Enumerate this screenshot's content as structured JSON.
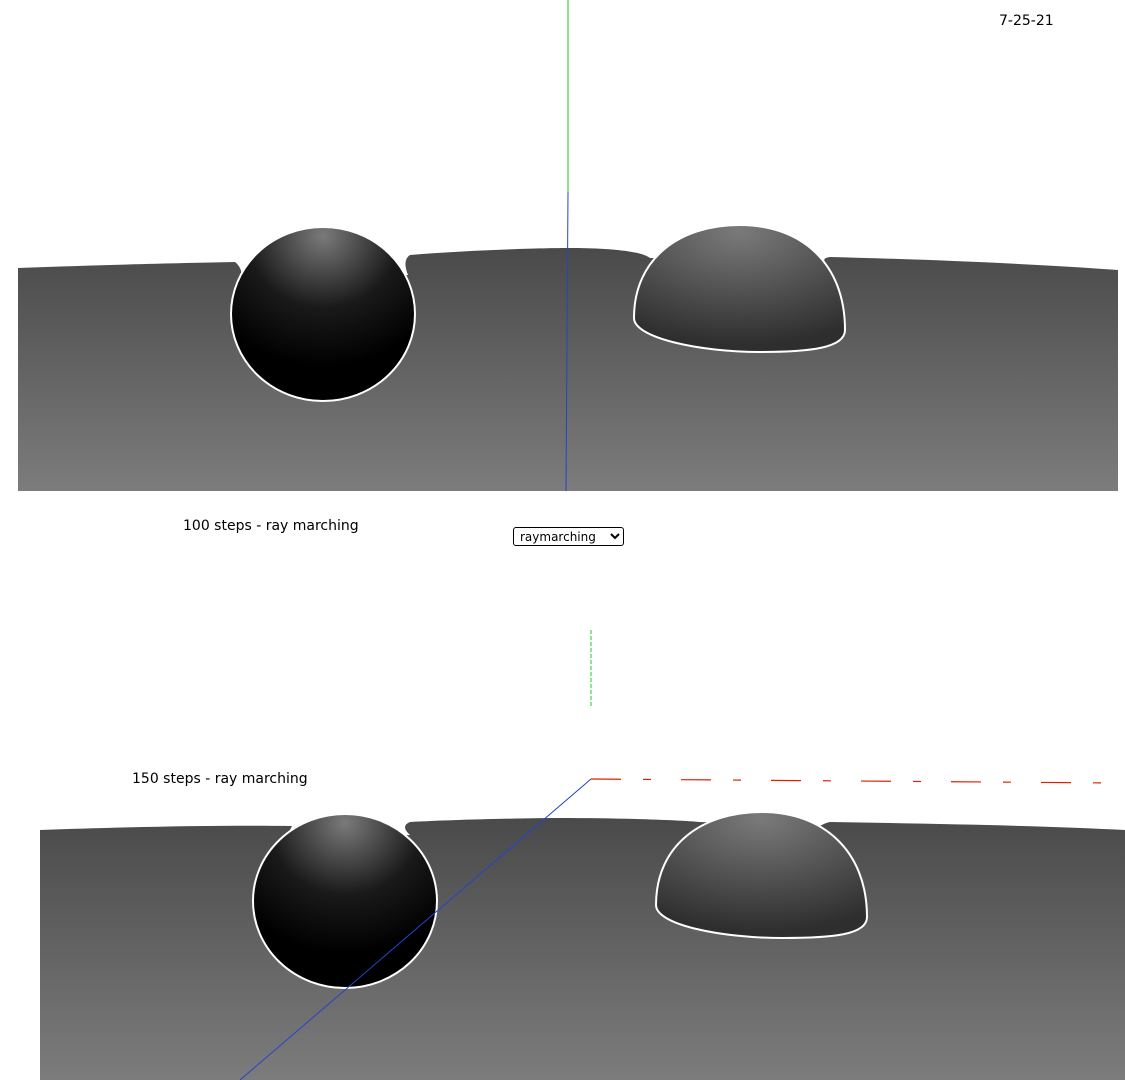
{
  "date": "7-25-21",
  "top_view": {
    "caption": "100 steps - ray marching"
  },
  "mode_select": {
    "selected": "raymarching",
    "options": [
      "raymarching"
    ]
  },
  "bottom_view": {
    "caption": "150 steps - ray marching"
  },
  "colors": {
    "axis_y": "#22cc22",
    "axis_z": "#2244cc",
    "axis_x": "#dd2200",
    "floor_far": "#4a4a4a",
    "floor_near": "#7a7a7a"
  }
}
